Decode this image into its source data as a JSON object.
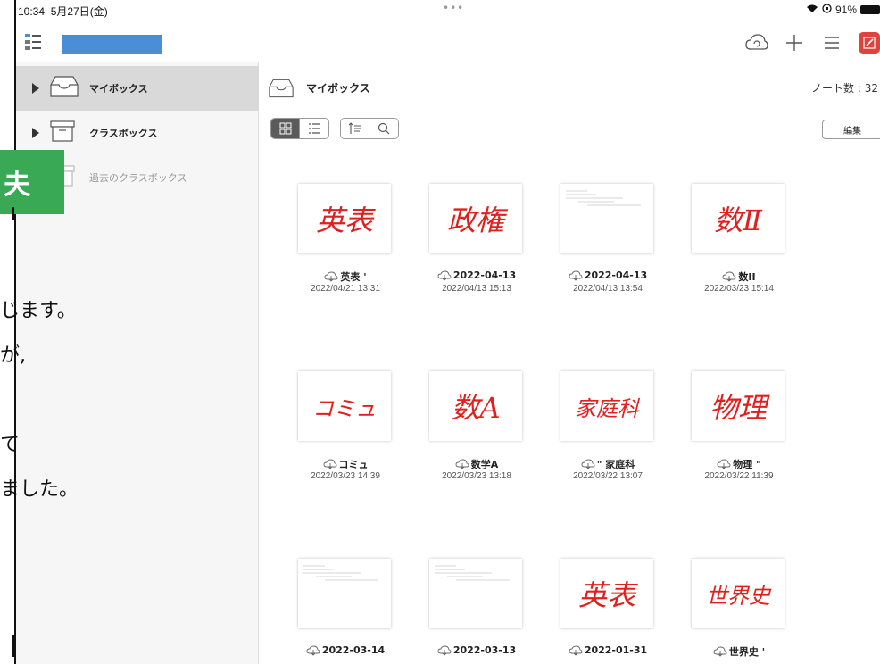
{
  "status": {
    "time": "10:34",
    "date": "5月27日(金)",
    "dots": "•••",
    "battery": "91%"
  },
  "toolbar": {
    "name_value": ""
  },
  "sidebar": {
    "items": [
      {
        "label": "マイボックス",
        "selected": true
      },
      {
        "label": "クラスボックス",
        "selected": false
      },
      {
        "label": "過去のクラスボックス",
        "selected": false
      }
    ]
  },
  "main": {
    "title": "マイボックス",
    "note_count": "ノート数 : 32",
    "edit_label": "編集"
  },
  "notes": [
    {
      "title": "英表 '",
      "date": "2022/04/21 13:31",
      "thumb_text": "英表",
      "thumb_color": "#e0201e"
    },
    {
      "title": "2022-04-13",
      "date": "2022/04/13 15:13",
      "thumb_text": "政権",
      "thumb_color": "#e0201e"
    },
    {
      "title": "2022-04-13",
      "date": "2022/04/13 13:54",
      "thumb_text": "",
      "thumb_color": "#e0201e"
    },
    {
      "title": "数II",
      "date": "2022/03/23 15:14",
      "thumb_text": "数Ⅱ",
      "thumb_color": "#e0201e"
    },
    {
      "title": "コミュ",
      "date": "2022/03/23 14:39",
      "thumb_text": "コミュ",
      "thumb_color": "#e0201e"
    },
    {
      "title": "数学A",
      "date": "2022/03/23 13:18",
      "thumb_text": "数A",
      "thumb_color": "#e0201e"
    },
    {
      "title": "\" 家庭科",
      "date": "2022/03/22 13:07",
      "thumb_text": "家庭科",
      "thumb_color": "#e0201e"
    },
    {
      "title": "物理 \"",
      "date": "2022/03/22 11:39",
      "thumb_text": "物理",
      "thumb_color": "#e0201e"
    },
    {
      "title": "2022-03-14",
      "date": "",
      "thumb_text": "",
      "thumb_color": "#e0201e"
    },
    {
      "title": "2022-03-13",
      "date": "",
      "thumb_text": "",
      "thumb_color": "#e0201e"
    },
    {
      "title": "2022-01-31",
      "date": "",
      "thumb_text": "英表",
      "thumb_color": "#e0201e"
    },
    {
      "title": "世界史 '",
      "date": "",
      "thumb_text": "世界史",
      "thumb_color": "#e0201e"
    }
  ],
  "article": {
    "badge": "夫",
    "lines": [
      "じます。",
      "が,",
      "て",
      "ました。"
    ]
  },
  "colors": {
    "accent_red": "#e0433d",
    "selection_blue": "#4a8ed6",
    "badge_green": "#3aa956"
  }
}
